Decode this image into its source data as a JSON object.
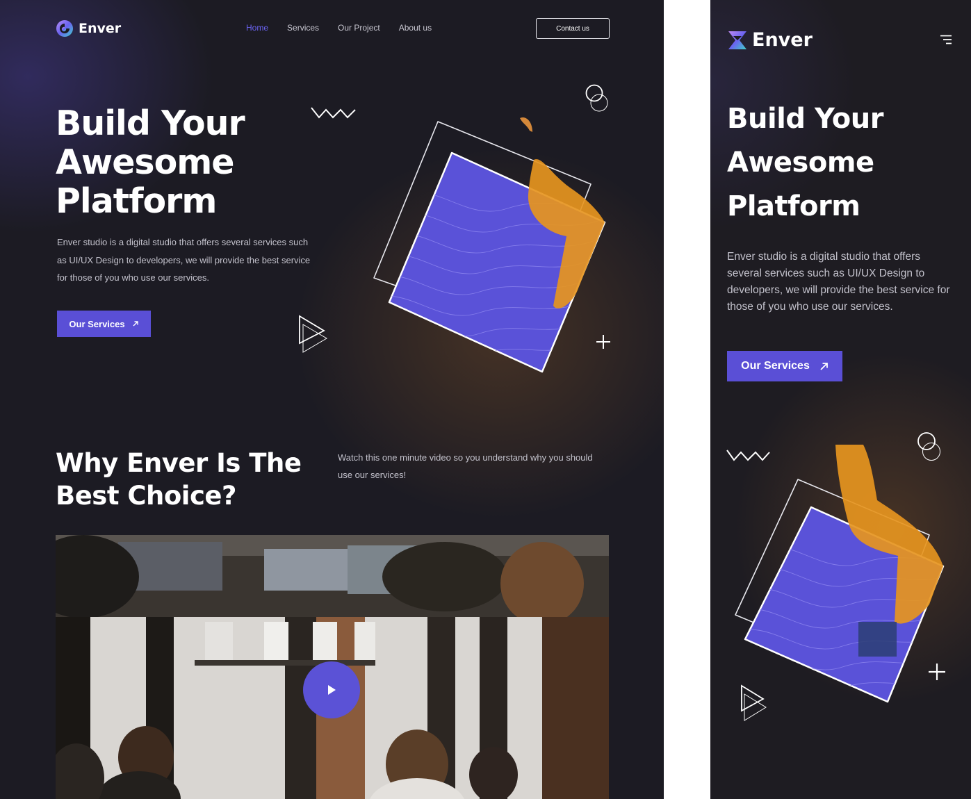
{
  "brand": {
    "name": "Enver",
    "accent": "#5a4fd6",
    "nav_active": "#6a63f0",
    "background": "#1c1b23"
  },
  "desktop": {
    "nav": [
      {
        "label": "Home",
        "active": true
      },
      {
        "label": "Services",
        "active": false
      },
      {
        "label": "Our Project",
        "active": false
      },
      {
        "label": "About us",
        "active": false
      }
    ],
    "contact_label": "Contact us",
    "hero": {
      "title": "Build Your Awesome Platform",
      "description": "Enver studio is a digital studio that offers several services such as UI/UX Design to developers, we will provide the best service for those of you who use our services.",
      "button_label": "Our Services",
      "button_icon": "arrow-up-right-icon"
    },
    "why": {
      "title": "Why Enver Is The Best Choice?",
      "description": "Watch this one minute video so you understand why you should use our services!"
    },
    "video": {
      "play_icon": "play-icon"
    }
  },
  "mobile": {
    "menu_icon": "hamburger-menu-icon",
    "hero": {
      "title": "Build Your Awesome Platform",
      "description": "Enver studio is a digital studio that offers several services such as UI/UX Design to developers, we will provide the best service for those of you who use our services.",
      "button_label": "Our Services",
      "button_icon": "arrow-up-right-icon"
    }
  }
}
